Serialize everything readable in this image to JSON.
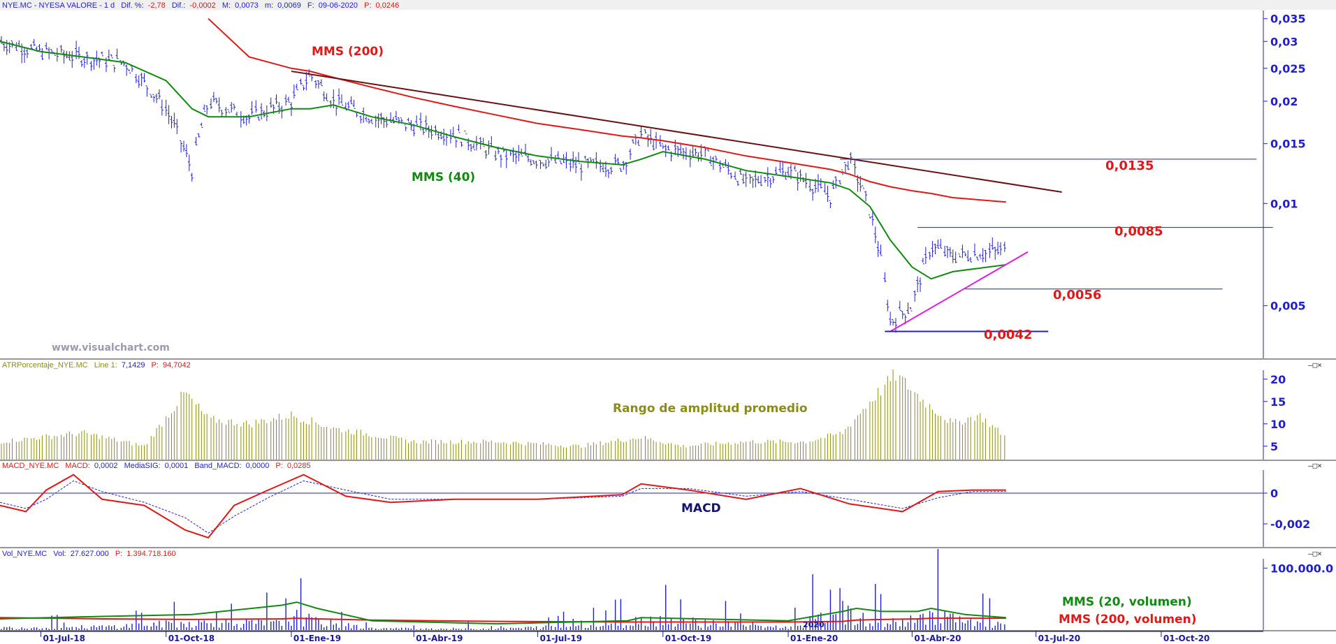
{
  "header": {
    "ticker": "NYE.MC - NYESA VALORE -  1 d",
    "dif_pct_label": "Dif. %:",
    "dif_pct": "-2,78",
    "dif_label": "Dif.:",
    "dif": "-0,0002",
    "max_label": "M:",
    "max": "0,0073",
    "min_label": "m:",
    "min": "0,0069",
    "date_label": "F:",
    "date": "09-06-2020",
    "p_label": "P:",
    "p": "0,0246"
  },
  "watermark": "www.visualchart.com",
  "panel_buttons": "–□×",
  "colors": {
    "price": "#1f1fd0",
    "mms40": "#118a11",
    "mms200": "#e01818",
    "trend": "#6b1010",
    "support": "#e020e0",
    "atr": "#8c8c1a",
    "macd": "#e01818",
    "signal": "#1f1fd0"
  },
  "annotations": {
    "mms200": "MMS (200)",
    "mms40": "MMS (40)",
    "level_0135": "0,0135",
    "level_0085": "0,0085",
    "level_0056": "0,0056",
    "level_0042": "0,0042",
    "atr_title": "Rango de amplitud promedio",
    "macd_title": "MACD",
    "vol_mms20": "MMS (20, volumen)",
    "vol_mms200": "MMS (200, volumen)",
    "year_2020": "2020"
  },
  "atr_header": {
    "name": "ATRPorcentaje_NYE.MC",
    "line_label": "Line 1:",
    "line": "7,1429",
    "p_label": "P:",
    "p": "94,7042"
  },
  "macd_header": {
    "name": "MACD_NYE.MC",
    "macd_label": "MACD:",
    "macd": "0,0002",
    "sig_label": "MediaSIG:",
    "sig": "0,0001",
    "band_label": "Band_MACD:",
    "band": "0,0000",
    "p_label": "P:",
    "p": "0,0285"
  },
  "vol_header": {
    "name": "Vol_NYE.MC",
    "vol_label": "Vol:",
    "vol": "27.627.000",
    "p_label": "P:",
    "p": "1.394.718.160"
  },
  "chart_data": [
    {
      "type": "line",
      "panel": "price",
      "x": [
        "2018-06-01",
        "2018-07-01",
        "2018-08-01",
        "2018-09-01",
        "2018-10-01",
        "2018-10-20",
        "2018-11-01",
        "2018-12-01",
        "2019-01-01",
        "2019-01-15",
        "2019-02-01",
        "2019-03-01",
        "2019-04-01",
        "2019-05-01",
        "2019-06-01",
        "2019-07-01",
        "2019-08-01",
        "2019-09-01",
        "2019-09-15",
        "2019-10-01",
        "2019-11-01",
        "2019-12-01",
        "2020-01-01",
        "2020-02-01",
        "2020-02-15",
        "2020-03-01",
        "2020-03-16",
        "2020-04-01",
        "2020-04-15",
        "2020-05-01",
        "2020-06-09"
      ],
      "series": [
        {
          "values": [
            0.03,
            0.028,
            0.027,
            0.026,
            0.019,
            0.0125,
            0.02,
            0.018,
            0.02,
            0.024,
            0.02,
            0.018,
            0.017,
            0.016,
            0.014,
            0.0135,
            0.013,
            0.013,
            0.016,
            0.0145,
            0.014,
            0.0115,
            0.0125,
            0.0105,
            0.0135,
            0.0095,
            0.0045,
            0.005,
            0.0075,
            0.007,
            0.0073
          ]
        },
        {
          "name": "MMS (40)",
          "values": [
            0.03,
            0.028,
            0.027,
            0.026,
            0.023,
            0.019,
            0.018,
            0.018,
            0.019,
            0.019,
            0.0195,
            0.018,
            0.017,
            0.0157,
            0.0146,
            0.0138,
            0.0133,
            0.013,
            0.0135,
            0.0142,
            0.0135,
            0.0125,
            0.012,
            0.0115,
            0.011,
            0.0098,
            0.0078,
            0.0065,
            0.006,
            0.0063,
            0.0066
          ]
        },
        {
          "name": "MMS (200)",
          "values": [
            null,
            null,
            null,
            null,
            null,
            null,
            0.035,
            0.027,
            0.025,
            0.0245,
            0.0235,
            0.022,
            0.0205,
            0.0193,
            0.0182,
            0.0172,
            0.0165,
            0.0158,
            0.0156,
            0.0153,
            0.0146,
            0.0138,
            0.0132,
            0.0126,
            0.0122,
            0.0116,
            0.0112,
            0.0109,
            0.0107,
            0.0104,
            0.0101
          ]
        }
      ],
      "trendline": {
        "from": [
          "2019-01-01",
          0.0245
        ],
        "to": [
          "2020-07-20",
          0.0108
        ]
      },
      "support_line": {
        "from": [
          "2020-03-16",
          0.0042
        ],
        "to": [
          "2020-06-25",
          0.0072
        ]
      },
      "levels": [
        0.0135,
        0.0085,
        0.0056,
        0.0042
      ],
      "y_ticks": [
        "0,035",
        "0,03",
        "0,025",
        "0,02",
        "0,015",
        "0,01",
        "0,005"
      ],
      "y_tick_values": [
        0.035,
        0.03,
        0.025,
        0.02,
        0.015,
        0.01,
        0.005
      ],
      "y_scale": "log",
      "x_ticks": [
        "01-Jul-18",
        "01-Oct-18",
        "01-Ene-19",
        "01-Abr-19",
        "01-Jul-19",
        "01-Oct-19",
        "01-Ene-20",
        "01-Abr-20",
        "01-Jul-20",
        "01-Oct-20"
      ],
      "x_tick_dates": [
        "2018-07-01",
        "2018-10-01",
        "2019-01-01",
        "2019-04-01",
        "2019-07-01",
        "2019-10-01",
        "2020-01-01",
        "2020-04-01",
        "2020-07-01",
        "2020-10-01"
      ],
      "x_range": [
        "2018-06-01",
        "2020-12-15"
      ]
    },
    {
      "type": "bar",
      "panel": "atr",
      "x": [
        "2018-06-01",
        "2018-08-01",
        "2018-09-15",
        "2018-10-15",
        "2018-11-01",
        "2018-12-01",
        "2019-01-01",
        "2019-02-01",
        "2019-04-01",
        "2019-06-01",
        "2019-08-01",
        "2019-09-15",
        "2019-10-15",
        "2019-12-01",
        "2020-01-15",
        "2020-02-10",
        "2020-03-01",
        "2020-03-20",
        "2020-04-10",
        "2020-05-01",
        "2020-05-20",
        "2020-06-09"
      ],
      "values": [
        6,
        8,
        5,
        17,
        11,
        10,
        12,
        9,
        6,
        6,
        5,
        7,
        5,
        6,
        6,
        8,
        15,
        21,
        15,
        10,
        12,
        7
      ],
      "y_ticks": [
        "20",
        "15",
        "10",
        "5"
      ],
      "y_tick_values": [
        20,
        15,
        10,
        5
      ],
      "y_range": [
        2,
        22
      ]
    },
    {
      "type": "line",
      "panel": "macd",
      "x": [
        "2018-06-01",
        "2018-06-20",
        "2018-07-05",
        "2018-07-25",
        "2018-08-15",
        "2018-09-15",
        "2018-10-15",
        "2018-11-01",
        "2018-11-20",
        "2018-12-15",
        "2019-01-10",
        "2019-02-10",
        "2019-03-15",
        "2019-05-01",
        "2019-07-01",
        "2019-09-01",
        "2019-09-15",
        "2019-10-20",
        "2019-12-01",
        "2020-01-10",
        "2020-02-15",
        "2020-03-25",
        "2020-04-20",
        "2020-05-15",
        "2020-06-09"
      ],
      "series": [
        {
          "name": "MACD",
          "values": [
            -0.0008,
            -0.0012,
            0.0002,
            0.0012,
            -0.0004,
            -0.0008,
            -0.0024,
            -0.0029,
            -0.0008,
            0.0002,
            0.0012,
            -0.0002,
            -0.0006,
            -0.0004,
            -0.0004,
            -0.0001,
            0.0006,
            0.0002,
            -0.0004,
            0.0003,
            -0.0007,
            -0.0012,
            0.0001,
            0.0002,
            0.0002
          ]
        },
        {
          "name": "MediaSIG",
          "values": [
            -0.0006,
            -0.001,
            -0.0004,
            0.0008,
            0.0001,
            -0.0006,
            -0.0016,
            -0.0026,
            -0.0015,
            -0.0003,
            0.0008,
            0.0002,
            -0.0004,
            -0.0004,
            -0.0004,
            -0.0002,
            0.0003,
            0.0003,
            -0.0002,
            0.0001,
            -0.0004,
            -0.001,
            -0.0003,
            0.0001,
            0.0001
          ]
        }
      ],
      "y_ticks": [
        "0",
        "-0,002"
      ],
      "y_tick_values": [
        0,
        -0.002
      ],
      "y_range": [
        -0.0035,
        0.0015
      ]
    },
    {
      "type": "bar",
      "panel": "volume",
      "x": [
        "2018-06-01",
        "2018-08-15",
        "2018-10-20",
        "2018-12-25",
        "2019-01-05",
        "2019-01-20",
        "2019-03-01",
        "2019-06-01",
        "2019-09-05",
        "2019-09-15",
        "2020-01-01",
        "2020-02-10",
        "2020-02-20",
        "2020-03-10",
        "2020-04-05",
        "2020-04-15",
        "2020-05-10",
        "2020-06-09"
      ],
      "values": [
        15000000,
        20000000,
        45000000,
        40000000,
        80000000,
        50000000,
        10000000,
        8000000,
        35000000,
        70000000,
        15000000,
        110000000,
        75000000,
        40000000,
        60000000,
        110000000,
        45000000,
        27627000
      ],
      "mms20": [
        18000000,
        22000000,
        25000000,
        40000000,
        45000000,
        35000000,
        15000000,
        10000000,
        15000000,
        20000000,
        15000000,
        30000000,
        35000000,
        30000000,
        30000000,
        35000000,
        25000000,
        20000000
      ],
      "mms200": [
        20000000,
        18000000,
        17000000,
        18000000,
        19000000,
        18000000,
        16000000,
        14000000,
        13000000,
        13000000,
        13000000,
        14000000,
        16000000,
        17000000,
        18000000,
        19000000,
        19000000,
        19000000
      ],
      "y_ticks": [
        "100.000.0"
      ],
      "y_tick_values": [
        100000000
      ],
      "y_range": [
        0,
        115000000
      ]
    }
  ]
}
